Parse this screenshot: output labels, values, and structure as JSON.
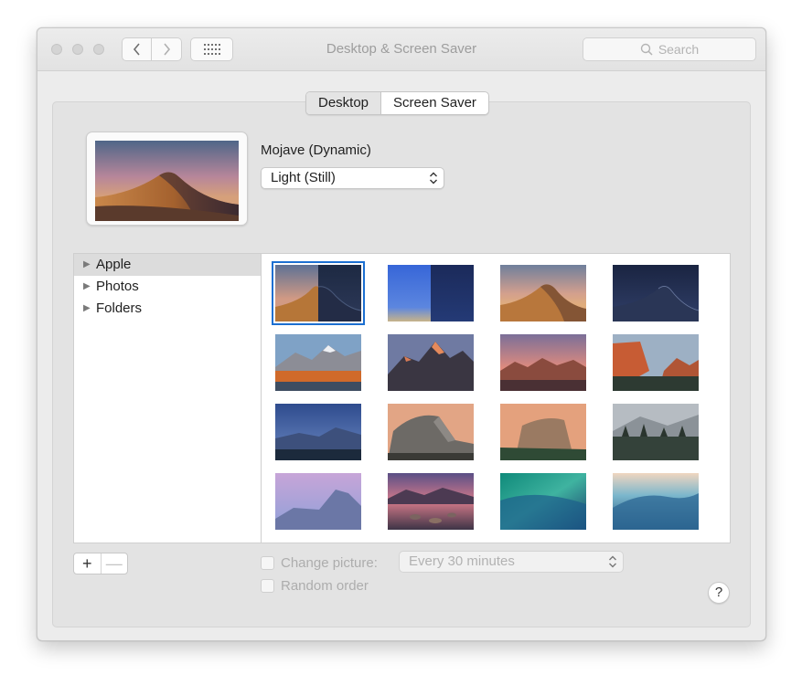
{
  "window": {
    "title": "Desktop & Screen Saver",
    "search_placeholder": "Search"
  },
  "tabs": [
    {
      "label": "Desktop",
      "selected": true
    },
    {
      "label": "Screen Saver",
      "selected": false
    }
  ],
  "wallpaper": {
    "name": "Mojave (Dynamic)",
    "mode_selected": "Light (Still)"
  },
  "sources": [
    {
      "label": "Apple",
      "selected": true
    },
    {
      "label": "Photos",
      "selected": false
    },
    {
      "label": "Folders",
      "selected": false
    }
  ],
  "thumbnails": [
    "mojave-dynamic",
    "solid-blue-gradient",
    "mojave-day",
    "mojave-night",
    "high-sierra",
    "sierra",
    "sierra-sunset",
    "el-capitan",
    "yosemite-valley",
    "half-dome",
    "el-capitan-rock",
    "yosemite-forest",
    "yosemite-purple",
    "lake-sunset",
    "wave-green",
    "wave-blue"
  ],
  "controls": {
    "add_label": "+",
    "remove_label": "—",
    "change_picture_label": "Change picture:",
    "change_picture_interval": "Every 30 minutes",
    "random_order_label": "Random order",
    "help_label": "?"
  }
}
